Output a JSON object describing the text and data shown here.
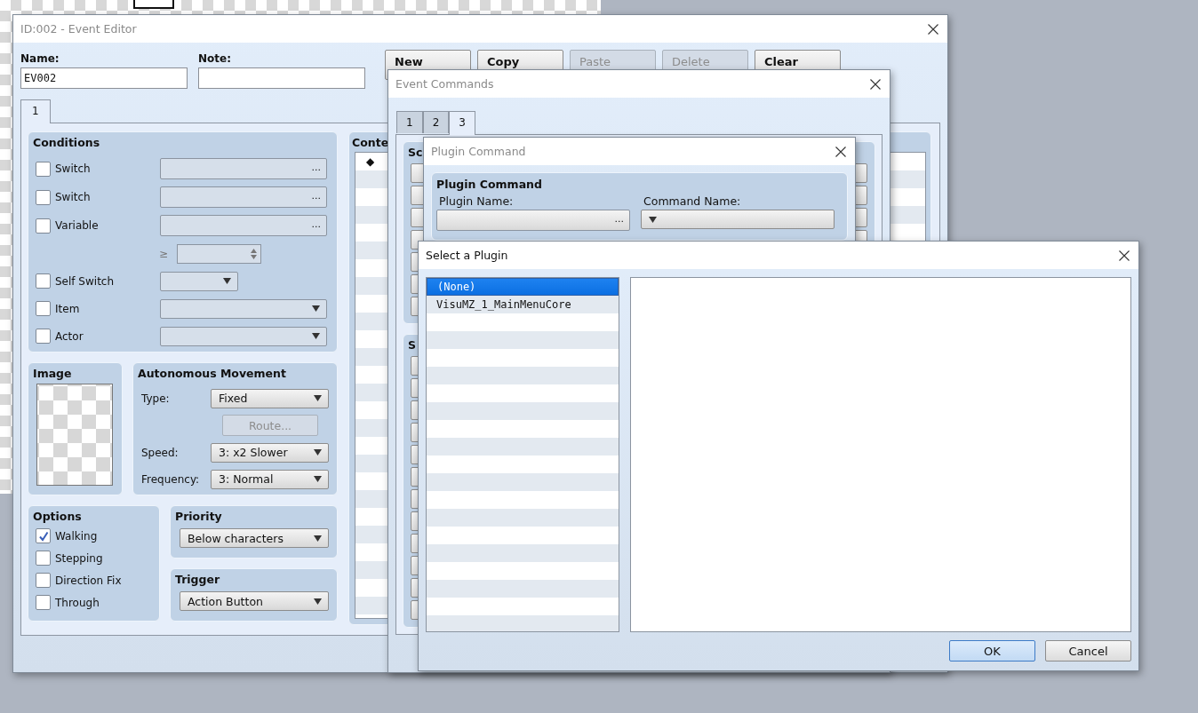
{
  "event_editor": {
    "title": "ID:002 - Event Editor",
    "name_field": {
      "label": "Name:",
      "value": "EV002"
    },
    "note_field": {
      "label": "Note:"
    },
    "buttons": [
      {
        "label": "New",
        "disabled": false
      },
      {
        "label": "Copy",
        "disabled": false
      },
      {
        "label": "Paste",
        "disabled": true
      },
      {
        "label": "Delete",
        "disabled": true
      },
      {
        "label": "Clear",
        "disabled": false
      }
    ],
    "tabs": [
      {
        "label": "1",
        "selected": true
      }
    ],
    "conditions": {
      "title": "Conditions",
      "rows": [
        {
          "kind": "picker",
          "label": "Switch",
          "checked": false,
          "button": "..."
        },
        {
          "kind": "picker",
          "label": "Switch",
          "checked": false,
          "button": "..."
        },
        {
          "kind": "picker",
          "label": "Variable",
          "checked": false,
          "button": "..."
        },
        {
          "kind": "compare",
          "operator": "≥"
        },
        {
          "kind": "short_dropdown",
          "label": "Self Switch",
          "checked": false
        },
        {
          "kind": "dropdown",
          "label": "Item",
          "checked": false
        },
        {
          "kind": "dropdown",
          "label": "Actor",
          "checked": false
        }
      ]
    },
    "contents": {
      "title": "Conte",
      "rows": [
        {
          "marker": "◆"
        }
      ]
    },
    "image": {
      "title": "Image"
    },
    "autonomous_movement": {
      "title": "Autonomous Movement",
      "rows": [
        {
          "kind": "dropdown",
          "label": "Type:",
          "value": "Fixed"
        },
        {
          "kind": "button",
          "label": "Route...",
          "disabled": true
        },
        {
          "kind": "dropdown",
          "label": "Speed:",
          "value": "3: x2 Slower"
        },
        {
          "kind": "dropdown",
          "label": "Frequency:",
          "value": "3: Normal"
        }
      ]
    },
    "options": {
      "title": "Options",
      "items": [
        {
          "label": "Walking",
          "checked": true
        },
        {
          "label": "Stepping",
          "checked": false
        },
        {
          "label": "Direction Fix",
          "checked": false
        },
        {
          "label": "Through",
          "checked": false
        }
      ]
    },
    "priority": {
      "title": "Priority",
      "value": "Below characters"
    },
    "trigger": {
      "title": "Trigger",
      "value": "Action Button"
    }
  },
  "event_commands": {
    "title": "Event Commands",
    "tabs": [
      {
        "label": "1",
        "selected": false
      },
      {
        "label": "2",
        "selected": false
      },
      {
        "label": "3",
        "selected": true
      }
    ],
    "groups": [
      {
        "heading": "Sc"
      },
      {
        "heading": "S"
      }
    ]
  },
  "plugin_command": {
    "title": "Plugin Command",
    "panel_title": "Plugin Command",
    "plugin_name": {
      "label": "Plugin Name:",
      "button": "..."
    },
    "command_name": {
      "label": "Command Name:"
    }
  },
  "select_plugin": {
    "title": "Select a Plugin",
    "plugins": [
      {
        "label": "(None)",
        "selected": true
      },
      {
        "label": "VisuMZ_1_MainMenuCore",
        "selected": false
      }
    ],
    "buttons": [
      {
        "label": "OK",
        "default": true
      },
      {
        "label": "Cancel",
        "default": false
      }
    ]
  }
}
